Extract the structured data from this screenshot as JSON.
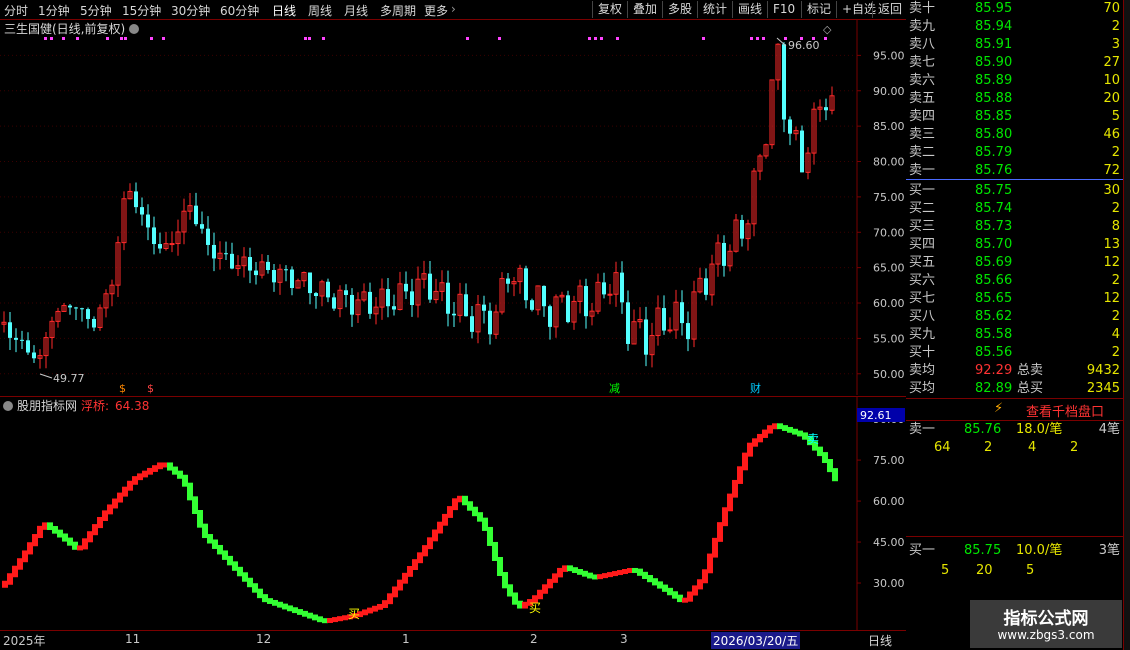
{
  "toolbar": {
    "periods": [
      "分时",
      "1分钟",
      "5分钟",
      "15分钟",
      "30分钟",
      "60分钟",
      "日线",
      "周线",
      "月线",
      "多周期",
      "更多"
    ],
    "active_period": "日线",
    "buttons": [
      "复权",
      "叠加",
      "多股",
      "统计",
      "画线",
      "F10",
      "标记",
      "+自选",
      "返回"
    ]
  },
  "main_chart": {
    "title": "三生国健(日线,前复权)",
    "price_axis": [
      "95.00",
      "90.00",
      "85.00",
      "80.00",
      "75.00",
      "70.00",
      "65.00",
      "60.00",
      "55.00",
      "50.00"
    ],
    "high_label": "96.60",
    "low_label": "49.77",
    "markers": [
      "$",
      "$",
      "减",
      "财"
    ],
    "colors": {
      "up": "#ff2a2a",
      "down": "#54ffff",
      "grid": "#7a0000",
      "axis_text": "#c8c8c8"
    }
  },
  "indicator": {
    "name": "股朋指标网",
    "line_label": "浮桥:",
    "line_value": "64.38",
    "axis_badge": "92.61",
    "axis": [
      "90.00",
      "75.00",
      "60.00",
      "45.00",
      "30.00"
    ],
    "signals": {
      "buy": "买",
      "sell": "卖"
    },
    "colors": {
      "rise": "#ff1a1a",
      "fall": "#33ff33"
    }
  },
  "date_axis": {
    "labels": [
      "2025年",
      "11",
      "12",
      "1",
      "2",
      "3"
    ],
    "cursor_date": "2026/03/20/五",
    "period": "日线"
  },
  "order_book": {
    "asks": [
      {
        "label": "卖十",
        "price": "85.95",
        "vol": "70"
      },
      {
        "label": "卖九",
        "price": "85.94",
        "vol": "2"
      },
      {
        "label": "卖八",
        "price": "85.91",
        "vol": "3"
      },
      {
        "label": "卖七",
        "price": "85.90",
        "vol": "27"
      },
      {
        "label": "卖六",
        "price": "85.89",
        "vol": "10"
      },
      {
        "label": "卖五",
        "price": "85.88",
        "vol": "20"
      },
      {
        "label": "卖四",
        "price": "85.85",
        "vol": "5"
      },
      {
        "label": "卖三",
        "price": "85.80",
        "vol": "46"
      },
      {
        "label": "卖二",
        "price": "85.79",
        "vol": "2"
      },
      {
        "label": "卖一",
        "price": "85.76",
        "vol": "72"
      }
    ],
    "bids": [
      {
        "label": "买一",
        "price": "85.75",
        "vol": "30"
      },
      {
        "label": "买二",
        "price": "85.74",
        "vol": "2"
      },
      {
        "label": "买三",
        "price": "85.73",
        "vol": "8"
      },
      {
        "label": "买四",
        "price": "85.70",
        "vol": "13"
      },
      {
        "label": "买五",
        "price": "85.69",
        "vol": "12"
      },
      {
        "label": "买六",
        "price": "85.66",
        "vol": "2"
      },
      {
        "label": "买七",
        "price": "85.65",
        "vol": "12"
      },
      {
        "label": "买八",
        "price": "85.62",
        "vol": "2"
      },
      {
        "label": "买九",
        "price": "85.58",
        "vol": "4"
      },
      {
        "label": "买十",
        "price": "85.56",
        "vol": "2"
      }
    ],
    "avg_sell_label": "卖均",
    "avg_sell": "92.29",
    "total_sell_label": "总卖",
    "total_sell": "9432",
    "avg_buy_label": "买均",
    "avg_buy": "82.89",
    "total_buy_label": "总买",
    "total_buy": "2345",
    "view_button": "查看千档盘口",
    "ask1": {
      "label": "卖一",
      "price": "85.76",
      "per": "18.0/笔",
      "count": "4笔",
      "orders": [
        "64",
        "2",
        "4",
        "2"
      ]
    },
    "bid1": {
      "label": "买一",
      "price": "85.75",
      "per": "10.0/笔",
      "count": "3笔",
      "orders": [
        "5",
        "20",
        "5"
      ]
    }
  },
  "watermark": {
    "title": "指标公式网",
    "url": "www.zbgs3.com"
  }
}
